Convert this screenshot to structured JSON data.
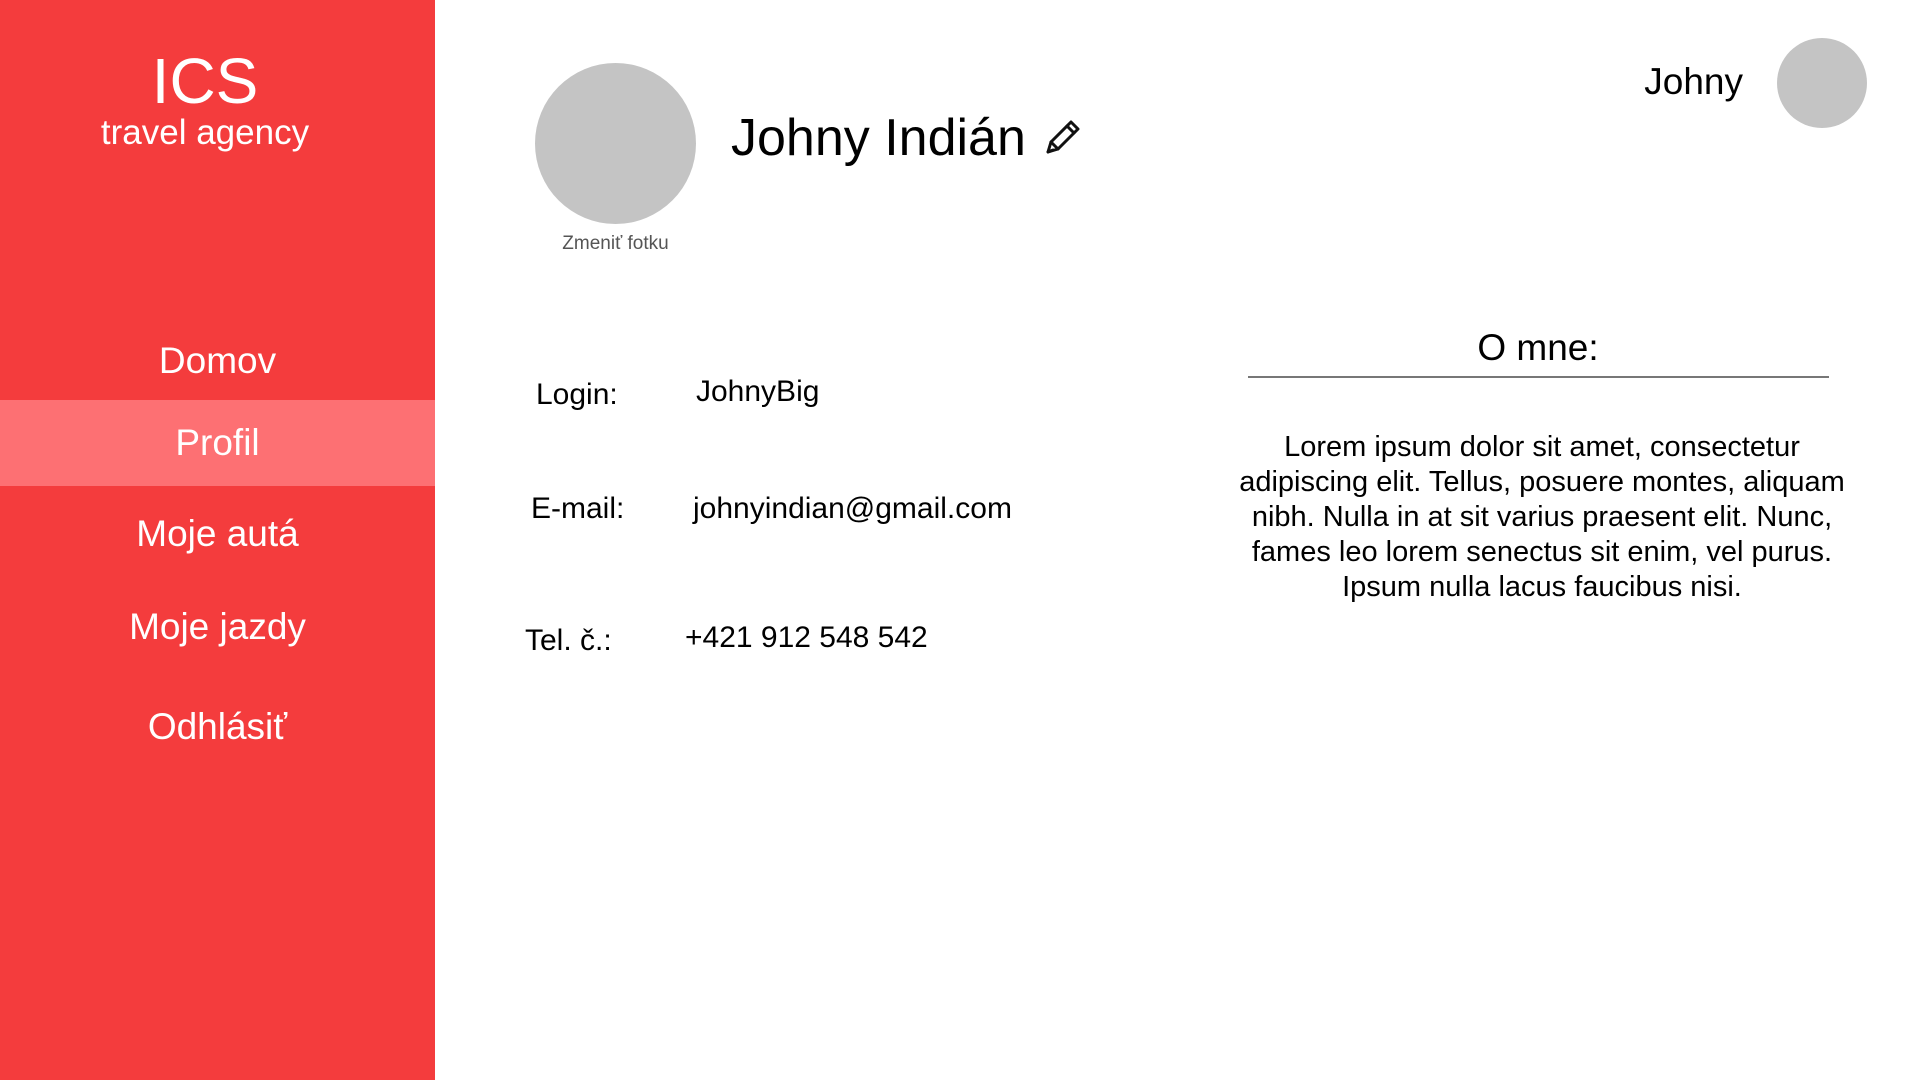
{
  "brand": {
    "title": "ICS",
    "subtitle": "travel agency"
  },
  "sidebar": {
    "items": [
      {
        "label": "Domov"
      },
      {
        "label": "Profil",
        "active": true
      },
      {
        "label": "Moje autá"
      },
      {
        "label": "Moje jazdy"
      },
      {
        "label": "Odhlásiť"
      }
    ]
  },
  "header": {
    "user_name": "Johny"
  },
  "profile": {
    "name": "Johny Indián",
    "change_photo_label": "Zmeniť fotku",
    "fields": {
      "login_label": "Login:",
      "login_value": "JohnyBig",
      "email_label": "E-mail:",
      "email_value": "johnyindian@gmail.com",
      "tel_label": "Tel. č.:",
      "tel_value": "+421 912 548 542"
    }
  },
  "about": {
    "title": "O mne:",
    "text": "Lorem ipsum dolor sit amet, consectetur adipiscing elit. Tellus, posuere montes, aliquam nibh. Nulla in at sit varius praesent elit. Nunc, fames leo lorem senectus sit enim, vel purus. Ipsum nulla lacus faucibus nisi."
  },
  "colors": {
    "sidebar": "#f43c3d",
    "sidebar_active": "#fd7073",
    "avatar_placeholder": "#c4c4c4"
  },
  "icons": {
    "edit": "pencil-icon"
  }
}
